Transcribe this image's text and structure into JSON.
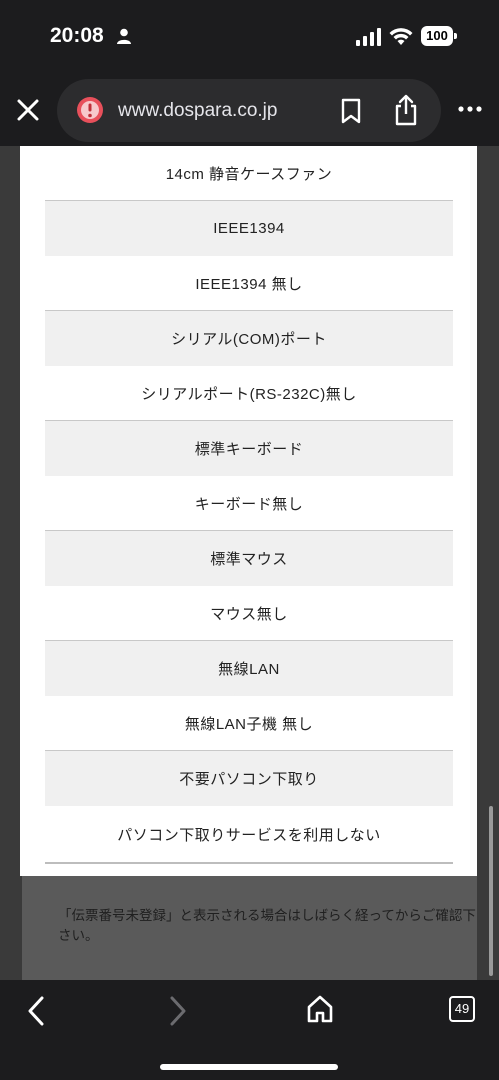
{
  "status_bar": {
    "time": "20:08",
    "battery": "100",
    "icons": [
      "person-icon",
      "signal-icon",
      "wifi-icon",
      "battery-icon"
    ]
  },
  "browser": {
    "url": "www.dospara.co.jp",
    "icons": [
      "close-icon",
      "warning-icon",
      "bookmark-icon",
      "share-icon",
      "more-icon"
    ]
  },
  "options": [
    "14cm 静音ケースファン",
    "IEEE1394",
    "IEEE1394 無し",
    "シリアル(COM)ポート",
    "シリアルポート(RS-232C)無し",
    "標準キーボード",
    "キーボード無し",
    "標準マウス",
    "マウス無し",
    "無線LAN",
    "無線LAN子機 無し",
    "不要パソコン下取り",
    "パソコン下取りサービスを利用しない"
  ],
  "background_page": {
    "notice": "「伝票番号未登録」と表示される場合はしばらく経ってからご確認下さい。"
  },
  "toolbar": {
    "tab_count": "49",
    "icons": [
      "back-icon",
      "forward-icon",
      "home-icon",
      "tabs-icon"
    ]
  },
  "colors": {
    "chrome_bg": "#1c1c1e",
    "url_pill": "#2c2c2e",
    "warning_red": "#e8505b",
    "modal_bg": "#ffffff",
    "option_alt_bg": "#f0f0f0"
  }
}
